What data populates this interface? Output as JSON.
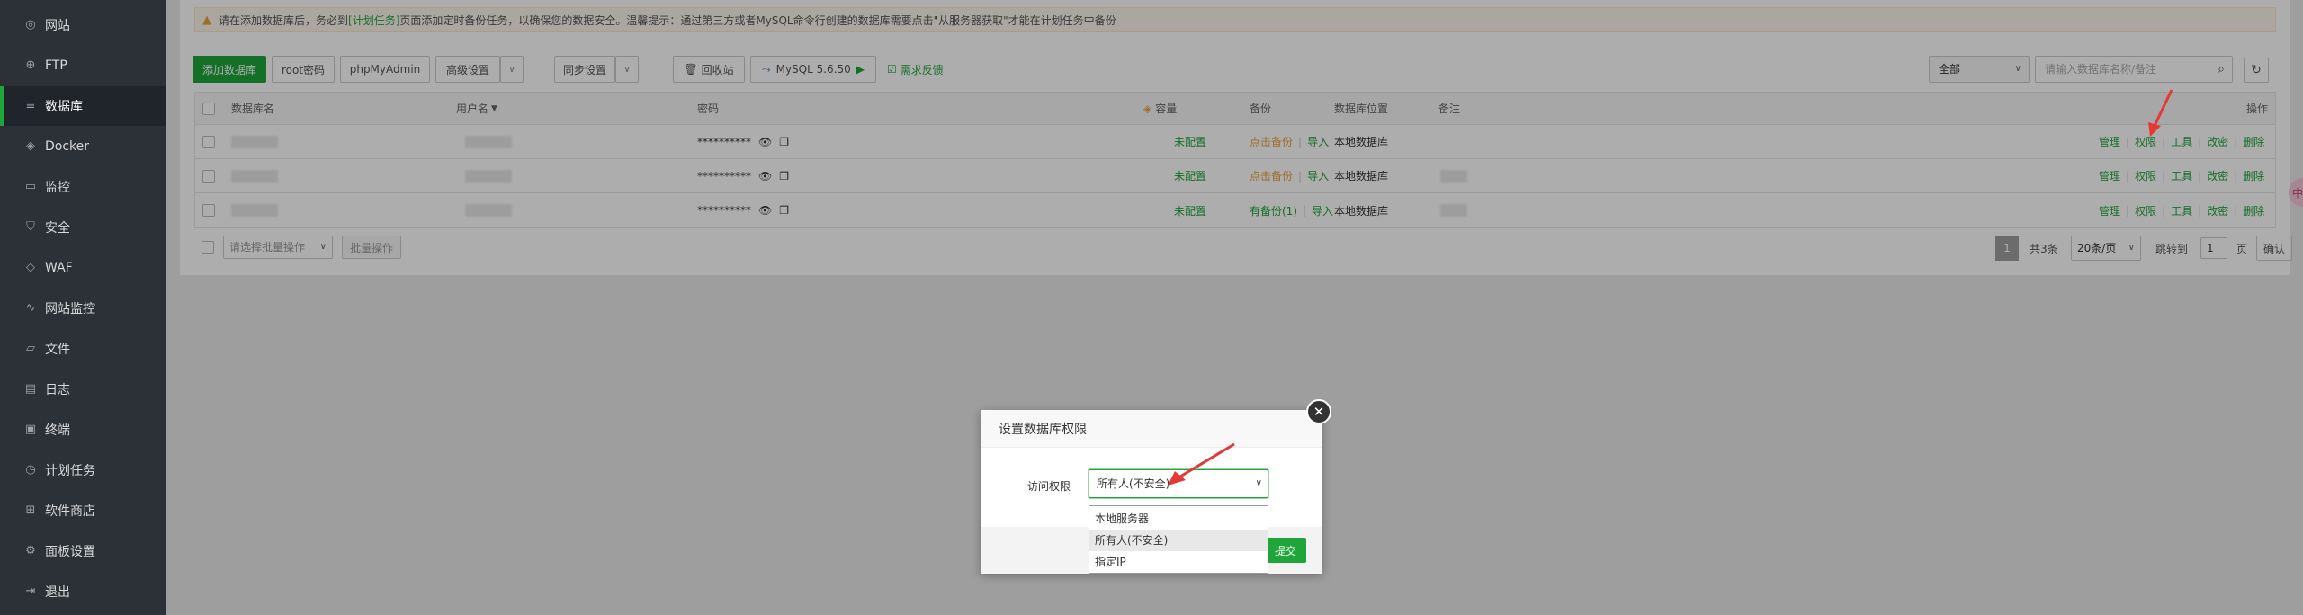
{
  "sidebar": {
    "items": [
      {
        "label": "网站",
        "icon": "globe-icon"
      },
      {
        "label": "FTP",
        "icon": "ftp-icon"
      },
      {
        "label": "数据库",
        "icon": "database-icon",
        "active": true
      },
      {
        "label": "Docker",
        "icon": "docker-icon"
      },
      {
        "label": "监控",
        "icon": "monitor-icon"
      },
      {
        "label": "安全",
        "icon": "shield-icon"
      },
      {
        "label": "WAF",
        "icon": "waf-icon"
      },
      {
        "label": "网站监控",
        "icon": "chart-icon"
      },
      {
        "label": "文件",
        "icon": "folder-icon"
      },
      {
        "label": "日志",
        "icon": "log-icon"
      },
      {
        "label": "终端",
        "icon": "terminal-icon"
      },
      {
        "label": "计划任务",
        "icon": "clock-icon"
      },
      {
        "label": "软件商店",
        "icon": "store-icon"
      },
      {
        "label": "面板设置",
        "icon": "gear-icon"
      },
      {
        "label": "退出",
        "icon": "logout-icon"
      }
    ]
  },
  "warning": {
    "prefix": "请在添加数据库后，务必到",
    "link": "[计划任务]",
    "suffix": "页面添加定时备份任务，以确保您的数据安全。温馨提示：通过第三方或者MySQL命令行创建的数据库需要点击\"从服务器获取\"才能在计划任务中备份"
  },
  "toolbar": {
    "add_db": "添加数据库",
    "root_pw": "root密码",
    "phpmyadmin": "phpMyAdmin",
    "advanced": "高级设置",
    "sync": "同步设置",
    "recycle": "回收站",
    "mysql": "MySQL 5.6.50",
    "feedback": "需求反馈",
    "filter_value": "全部",
    "search_placeholder": "请输入数据库名称/备注"
  },
  "table": {
    "headers": {
      "name": "数据库名",
      "user": "用户名",
      "password": "密码",
      "capacity": "容量",
      "backup": "备份",
      "location": "数据库位置",
      "note": "备注",
      "ops": "操作"
    },
    "rows": [
      {
        "password": "**********",
        "capacity": "未配置",
        "backup_link": "点击备份",
        "import": "导入",
        "location": "本地数据库"
      },
      {
        "password": "**********",
        "capacity": "未配置",
        "backup_link": "点击备份",
        "import": "导入",
        "location": "本地数据库"
      },
      {
        "password": "**********",
        "capacity": "未配置",
        "backup_link": "有备份(1)",
        "import": "导入",
        "location": "本地数据库"
      }
    ],
    "ops": {
      "manage": "管理",
      "perm": "权限",
      "tools": "工具",
      "change_pw": "改密",
      "delete": "删除"
    }
  },
  "footer": {
    "batch_placeholder": "请选择批量操作",
    "batch_btn": "批量操作",
    "current_page": "1",
    "total": "共3条",
    "per_page": "20条/页",
    "jump_label": "跳转到",
    "jump_value": "1",
    "page_unit": "页",
    "confirm": "确认"
  },
  "float_tab": "中",
  "dialog": {
    "title": "设置数据库权限",
    "label": "访问权限",
    "selected": "所有人(不安全)",
    "options": [
      "本地服务器",
      "所有人(不安全)",
      "指定IP"
    ],
    "submit": "提交"
  }
}
